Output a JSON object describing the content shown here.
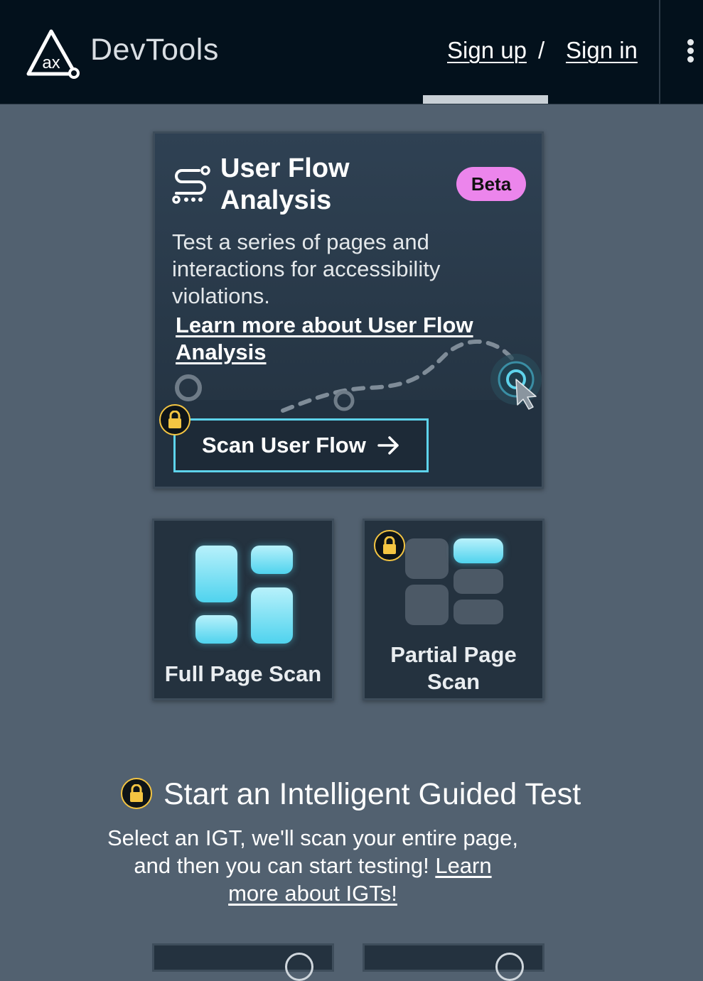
{
  "header": {
    "brand": "DevTools",
    "logo_text": "ax",
    "sign_up": "Sign up",
    "separator": "/",
    "sign_in": "Sign in",
    "menu_icon": "kebab-menu-icon"
  },
  "user_flow": {
    "title": "User Flow Analysis",
    "badge": "Beta",
    "description": "Test a series of pages and interactions for accessibility violations.",
    "learn_more": "Learn more about User Flow Analysis",
    "button_label": "Scan User Flow",
    "button_icon": "arrow-right-icon",
    "locked": true
  },
  "scans": {
    "full_page": {
      "label": "Full Page Scan"
    },
    "partial_page": {
      "label": "Partial Page Scan",
      "locked": true
    }
  },
  "igt": {
    "title": "Start an Intelligent Guided Test",
    "description": "Select an IGT, we'll scan your entire page, and then you can start testing!",
    "learn_more": "Learn more about IGTs!",
    "locked": true
  },
  "colors": {
    "page_bg": "#526170",
    "header_bg": "#03111c",
    "accent_cyan": "#5ed3eb",
    "beta_pink": "#ec85ec",
    "lock_gold": "#f4c542"
  }
}
